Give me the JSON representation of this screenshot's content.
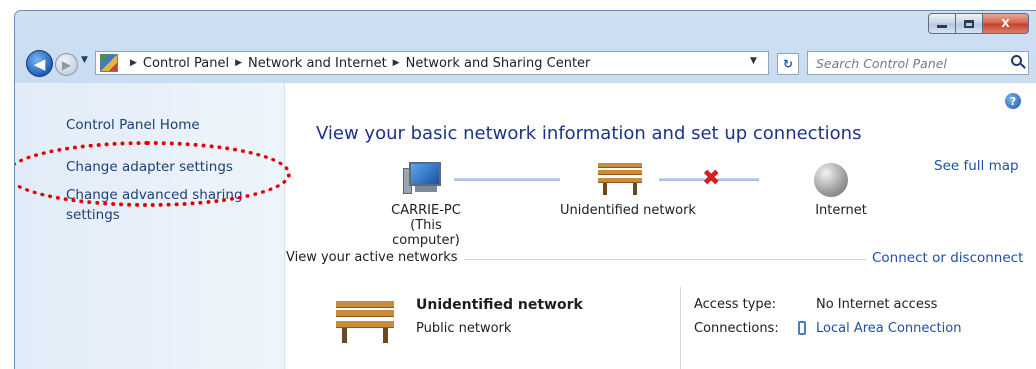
{
  "window": {
    "controls": {
      "minimize": "–",
      "maximize": "□",
      "close": "X"
    }
  },
  "navbar": {
    "back_glyph": "◀",
    "forward_glyph": "▶",
    "recent_glyph": "▼",
    "breadcrumbs": [
      "Control Panel",
      "Network and Internet",
      "Network and Sharing Center"
    ],
    "crumb_separator": "▶",
    "address_dropdown": "▼",
    "refresh_glyph": "↻",
    "search_placeholder": "Search Control Panel"
  },
  "sidebar": {
    "items": [
      {
        "label": "Control Panel Home"
      },
      {
        "label": "Change adapter settings"
      },
      {
        "label": "Change advanced sharing settings"
      }
    ],
    "highlight_color": "#e00000"
  },
  "main": {
    "help_glyph": "?",
    "title": "View your basic network information and set up connections",
    "see_full_map": "See full map",
    "map": {
      "computer_name": "CARRIE-PC",
      "computer_sub": "(This computer)",
      "network_name": "Unidentified network",
      "internet_label": "Internet",
      "broken_link_glyph": "✖"
    },
    "active_networks_label": "View your active networks",
    "connect_or_disconnect": "Connect or disconnect",
    "active": {
      "name": "Unidentified network",
      "type": "Public network",
      "access_type_label": "Access type:",
      "access_type_value": "No Internet access",
      "connections_label": "Connections:",
      "connections_value": "Local Area Connection"
    }
  },
  "icons": {
    "back": "back-arrow-icon",
    "forward": "forward-arrow-icon",
    "control_panel": "control-panel-icon",
    "refresh": "refresh-icon",
    "search": "search-icon",
    "help": "help-icon",
    "computer": "computer-icon",
    "network": "bench-network-icon",
    "internet": "globe-icon",
    "lan": "lan-connection-icon"
  },
  "colors": {
    "link": "#1e4fa8",
    "title": "#1e3287",
    "sidebar_link": "#1e3f78",
    "error_x": "#d42020"
  }
}
